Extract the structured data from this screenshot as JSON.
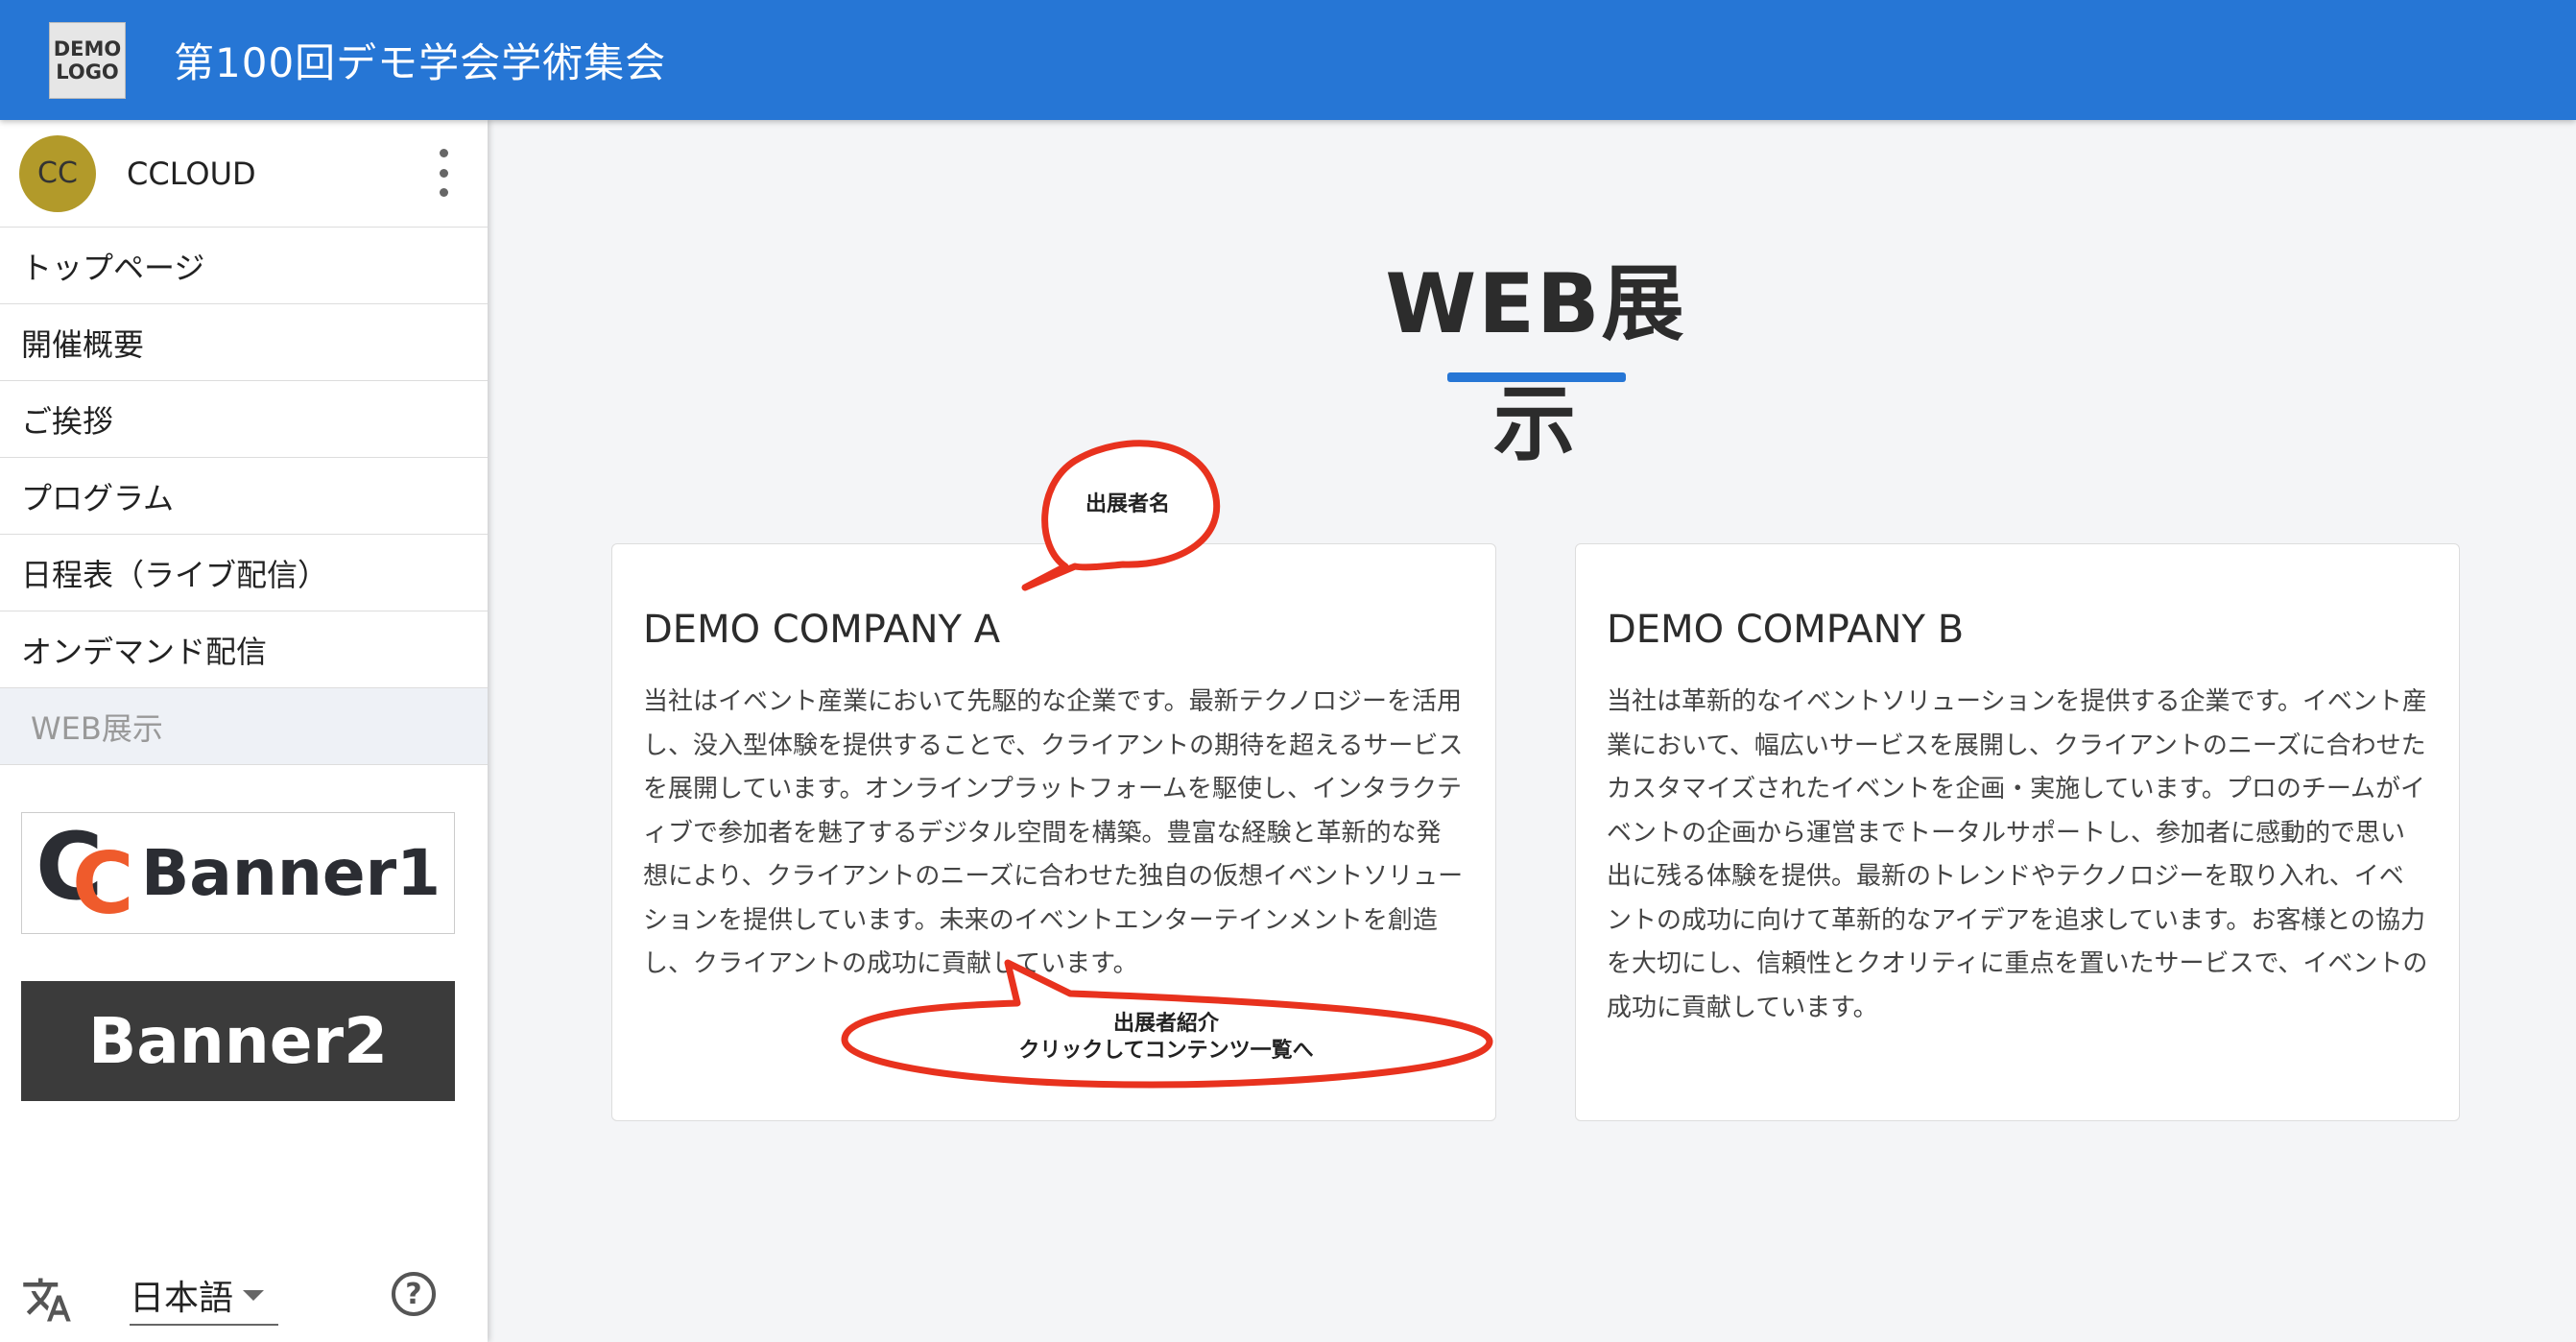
{
  "header": {
    "logo_line1": "DEMO",
    "logo_line2": "LOGO",
    "site_title": "第100回デモ学会学術集会",
    "color": "#2676d5"
  },
  "sidebar": {
    "user": {
      "initials": "CC",
      "name": "CCLOUD"
    },
    "items": [
      {
        "label": "トップページ"
      },
      {
        "label": "開催概要"
      },
      {
        "label": "ご挨拶"
      },
      {
        "label": "プログラム"
      },
      {
        "label": "日程表（ライブ配信）"
      },
      {
        "label": "オンデマンド配信"
      },
      {
        "label": "WEB展示",
        "active": true
      }
    ],
    "banners": {
      "banner1": "Banner1",
      "banner2": "Banner2"
    },
    "footer": {
      "language": "日本語",
      "translate_icon": "translate-icon",
      "help_icon": "help-icon"
    }
  },
  "main": {
    "heading": "WEB展示",
    "cards": [
      {
        "title": "DEMO COMPANY A",
        "description": "当社はイベント産業において先駆的な企業です。最新テクノロジーを活用し、没入型体験を提供することで、クライアントの期待を超えるサービスを展開しています。オンラインプラットフォームを駆使し、インタラクティブで参加者を魅了するデジタル空間を構築。豊富な経験と革新的な発想により、クライアントのニーズに合わせた独自の仮想イベントソリューションを提供しています。未来のイベントエンターテインメントを創造し、クライアントの成功に貢献しています。"
      },
      {
        "title": "DEMO COMPANY B",
        "description": "当社は革新的なイベントソリューションを提供する企業です。イベント産業において、幅広いサービスを展開し、クライアントのニーズに合わせたカスタマイズされたイベントを企画・実施しています。プロのチームがイベントの企画から運営までトータルサポートし、参加者に感動的で思い出に残る体験を提供。最新のトレンドやテクノロジーを取り入れ、イベントの成功に向けて革新的なアイデアを追求しています。お客様との協力を大切にし、信頼性とクオリティに重点を置いたサービスで、イベントの成功に貢献しています。"
      }
    ]
  },
  "annotations": {
    "exhibitor_name": "出展者名",
    "exhibitor_intro_line1": "出展者紹介",
    "exhibitor_intro_line2": "クリックしてコンテンツ一覧へ",
    "color": "#e8321e"
  }
}
